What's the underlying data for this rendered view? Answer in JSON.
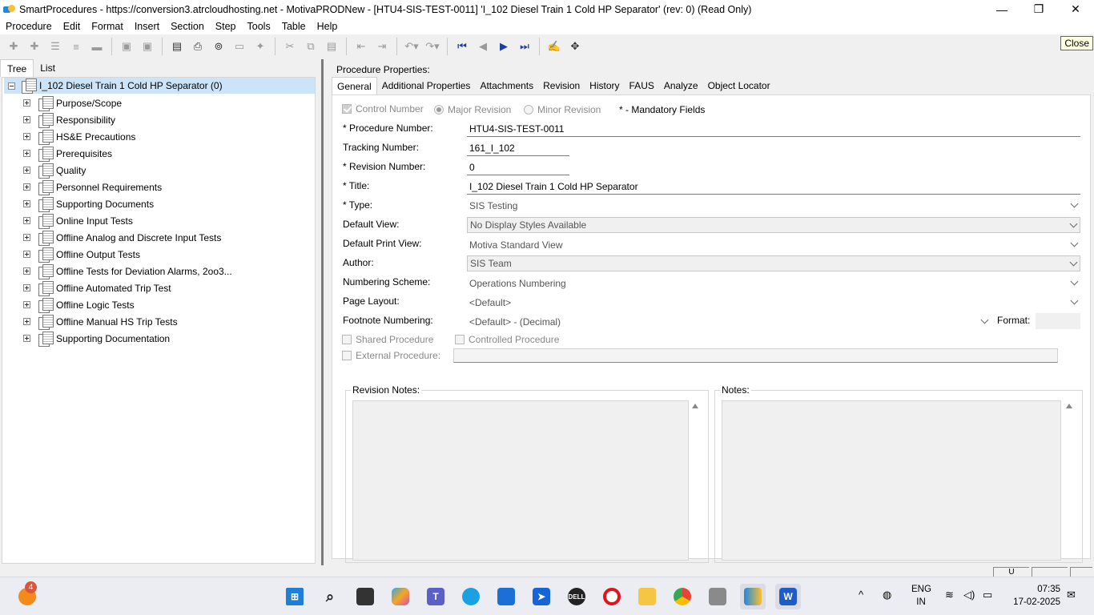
{
  "window": {
    "title": "SmartProcedures - https://conversion3.atrcloudhosting.net - MotivaPRODNew - [HTU4-SIS-TEST-0011] 'I_102 Diesel Train 1 Cold HP Separator' (rev: 0) (Read Only)",
    "minimize": "—",
    "maximize": "❐",
    "close": "✕"
  },
  "menu": [
    "Procedure",
    "Edit",
    "Format",
    "Insert",
    "Section",
    "Step",
    "Tools",
    "Table",
    "Help"
  ],
  "tooltip": {
    "close": "Close"
  },
  "left": {
    "tabs": [
      "Tree",
      "List"
    ],
    "root": "I_102 Diesel Train 1 Cold HP Separator (0)",
    "items": [
      "Purpose/Scope",
      "Responsibility",
      "HS&E Precautions",
      "Prerequisites",
      "Quality",
      "Personnel Requirements",
      "Supporting Documents",
      "Online Input Tests",
      "Offline Analog and Discrete Input Tests",
      "Offline Output Tests",
      "Offline Tests for Deviation Alarms, 2oo3...",
      "Offline Automated Trip Test",
      "Offline Logic Tests",
      "Offline Manual HS Trip Tests",
      "Supporting Documentation"
    ]
  },
  "right": {
    "header": "Procedure Properties:",
    "tabs": [
      "General",
      "Additional Properties",
      "Attachments",
      "Revision",
      "History",
      "FAUS",
      "Analyze",
      "Object Locator"
    ],
    "control_number": "Control Number",
    "major_revision": "Major Revision",
    "minor_revision": "Minor Revision",
    "mandatory": "* - Mandatory Fields",
    "fields": {
      "procedure_number": {
        "label": "* Procedure Number:",
        "value": "HTU4-SIS-TEST-0011"
      },
      "tracking_number": {
        "label": "Tracking Number:",
        "value": "161_I_102"
      },
      "revision_number": {
        "label": "* Revision Number:",
        "value": "0"
      },
      "title": {
        "label": "* Title:",
        "value": "I_102 Diesel Train 1 Cold HP Separator"
      },
      "type": {
        "label": "* Type:",
        "value": "SIS Testing"
      },
      "default_view": {
        "label": "Default View:",
        "value": "No Display Styles Available"
      },
      "default_print_view": {
        "label": "Default Print View:",
        "value": "Motiva Standard View"
      },
      "author": {
        "label": "Author:",
        "value": "SIS Team"
      },
      "numbering_scheme": {
        "label": "Numbering Scheme:",
        "value": "Operations Numbering"
      },
      "page_layout": {
        "label": "Page Layout:",
        "value": "<Default>"
      },
      "footnote_numbering": {
        "label": "Footnote Numbering:",
        "value": "<Default> - (Decimal)"
      },
      "format": {
        "label": "Format:",
        "value": ""
      }
    },
    "shared_procedure": "Shared Procedure",
    "controlled_procedure": "Controlled Procedure",
    "external_procedure": "External Procedure:",
    "revision_notes": "Revision Notes:",
    "notes": "Notes:"
  },
  "status": {
    "cell1": "U"
  },
  "taskbar": {
    "badge": "4",
    "lang": "ENG",
    "region": "IN",
    "time": "07:35",
    "date": "17-02-2025"
  }
}
